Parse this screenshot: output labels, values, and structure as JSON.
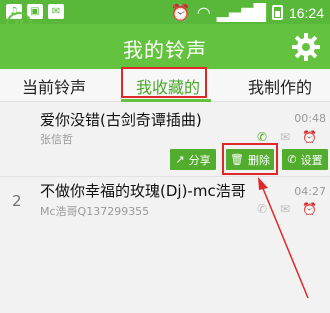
{
  "statusbar": {
    "time": "16:24"
  },
  "appbar": {
    "title": "我的铃声"
  },
  "tabs": [
    {
      "label": "当前铃声"
    },
    {
      "label": "我收藏的"
    },
    {
      "label": "我制作的"
    }
  ],
  "songs": [
    {
      "title": "爱你没错(古剑奇谭插曲)",
      "artist": "张信哲",
      "duration": "00:48"
    },
    {
      "index": "2",
      "title": "不做你幸福的玫瑰(Dj)-mc浩哥",
      "artist": "Mc浩哥Q137299355",
      "duration": "04:27"
    }
  ],
  "actions": {
    "share": "分享",
    "delete": "删除",
    "set": "设置"
  },
  "colors": {
    "accent": "#64c33e",
    "highlight": "#e12828"
  }
}
